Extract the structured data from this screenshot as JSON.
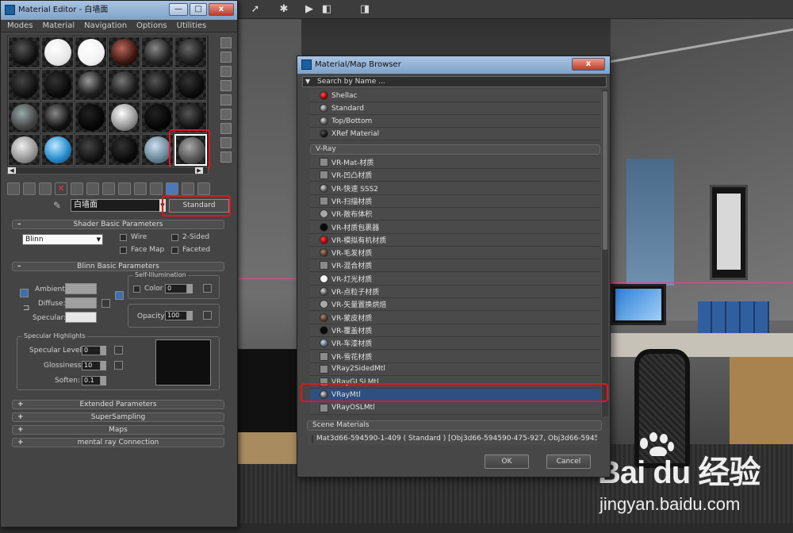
{
  "material_editor": {
    "title": "Material Editor - 白墙面",
    "window_buttons": {
      "minimize": "—",
      "maximize": "□",
      "close": "x"
    },
    "menu": [
      "Modes",
      "Material",
      "Navigation",
      "Options",
      "Utilities"
    ],
    "material_name": "白墙面",
    "material_type": "Standard",
    "shader_basic": {
      "title": "Shader Basic Parameters",
      "shader": "Blinn",
      "wire": "Wire",
      "two_sided": "2-Sided",
      "face_map": "Face Map",
      "faceted": "Faceted"
    },
    "blinn_basic": {
      "title": "Blinn Basic Parameters",
      "self_illumination": "Self-Illumination",
      "ambient": "Ambient:",
      "diffuse": "Diffuse:",
      "specular": "Specular:",
      "color": "Color",
      "color_value": "0",
      "opacity": "Opacity:",
      "opacity_value": "100"
    },
    "specular_highlights": {
      "title": "Specular Highlights",
      "specular_level": "Specular Level:",
      "specular_level_value": "0",
      "glossiness": "Glossiness:",
      "glossiness_value": "10",
      "soften": "Soften:",
      "soften_value": "0.1"
    },
    "rollouts": [
      "Extended Parameters",
      "SuperSampling",
      "Maps",
      "mental ray Connection"
    ]
  },
  "browser": {
    "title": "Material/Map Browser",
    "close": "x",
    "search_placeholder": "Search by Name ...",
    "standard_items": [
      {
        "label": "Shellac",
        "icon": "red-sphere-icon"
      },
      {
        "label": "Standard",
        "icon": "grey-sphere-icon"
      },
      {
        "label": "Top/Bottom",
        "icon": "grey-sphere-icon"
      },
      {
        "label": "XRef Material",
        "icon": "dark-sphere-icon"
      }
    ],
    "vray_group": "V-Ray",
    "vray_items": [
      "VR-Mat-材质",
      "VR-凹凸材质",
      "VR-快速 SSS2",
      "VR-扫描材质",
      "VR-散布体积",
      "VR-材质包裹器",
      "VR-模拟有机材质",
      "VR-毛发材质",
      "VR-混合材质",
      "VR-灯光材质",
      "VR-点粒子材质",
      "VR-矢量置换烘焙",
      "VR-蒙皮材质",
      "VR-覆盖材质",
      "VR-车漆材质",
      "VR-雪花材质",
      "VRay2SidedMtl",
      "VRayGLSLMtl",
      "VRayMtl",
      "VRayOSLMtl"
    ],
    "selected_item": "VRayMtl",
    "scene_group": "Scene Materials",
    "scene_item": "Mat3d66-594590-1-409  ( Standard )  [Obj3d66-594590-475-927, Obj3d66-5945...",
    "ok": "OK",
    "cancel": "Cancel"
  },
  "watermark": {
    "logo": "Bai  du 经验",
    "url": "jingyan.baidu.com"
  },
  "colors": {
    "highlight_red": "#e3151a",
    "selection_blue": "#2f4f80"
  }
}
